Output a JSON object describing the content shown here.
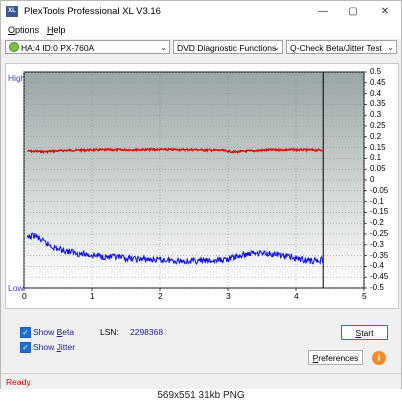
{
  "window": {
    "title": "PlexTools Professional XL V3.16",
    "app_icon": "XL",
    "minimize": "—",
    "maximize": "▢",
    "close": "✕"
  },
  "menu": [
    {
      "label": "Options",
      "accel": "O",
      "rest": "ptions"
    },
    {
      "label": "Help",
      "accel": "H",
      "rest": "elp"
    }
  ],
  "toolbar": {
    "drive": "HA:4 ID:0  PX-760A",
    "function": "DVD Diagnostic Functions",
    "test": "Q-Check Beta/Jitter Test"
  },
  "chart_data": {
    "type": "line",
    "left_axis": {
      "top_label": "High",
      "bottom_label": "Low"
    },
    "x_ticks": [
      "0",
      "1",
      "2",
      "3",
      "4",
      "5"
    ],
    "xlim": [
      0,
      5
    ],
    "y_ticks": [
      "0.5",
      "0.45",
      "0.4",
      "0.35",
      "0.3",
      "0.25",
      "0.2",
      "0.15",
      "0.1",
      "0.05",
      "0",
      "-0.05",
      "-0.1",
      "-0.15",
      "-0.2",
      "-0.25",
      "-0.3",
      "-0.35",
      "-0.4",
      "-0.45",
      "-0.5"
    ],
    "ylim": [
      -0.5,
      0.5
    ],
    "end_marker_x": 4.4,
    "background_top": "#9aa5a5",
    "background_bottom": "#ffffff",
    "series": [
      {
        "color": "#e00000",
        "x": [
          0.05,
          0.3,
          0.6,
          1.0,
          1.5,
          2.0,
          2.5,
          2.9,
          3.1,
          3.3,
          3.6,
          4.0,
          4.4
        ],
        "y": [
          0.134,
          0.131,
          0.137,
          0.139,
          0.14,
          0.141,
          0.14,
          0.137,
          0.13,
          0.134,
          0.139,
          0.14,
          0.138
        ]
      },
      {
        "color": "#1010e0",
        "x": [
          0.05,
          0.15,
          0.3,
          0.5,
          0.8,
          1.2,
          1.6,
          2.0,
          2.4,
          2.8,
          3.0,
          3.2,
          3.4,
          3.6,
          3.9,
          4.2,
          4.4
        ],
        "y": [
          -0.27,
          -0.255,
          -0.29,
          -0.32,
          -0.34,
          -0.355,
          -0.365,
          -0.37,
          -0.375,
          -0.375,
          -0.365,
          -0.35,
          -0.335,
          -0.34,
          -0.355,
          -0.375,
          -0.37
        ]
      }
    ]
  },
  "controls": {
    "show_beta": {
      "checked": true,
      "label_pre": "Show ",
      "accel": "B",
      "label_post": "eta"
    },
    "show_jitter": {
      "checked": true,
      "label_pre": "Show ",
      "accel": "J",
      "label_post": "itter"
    },
    "lsn_label": "LSN:",
    "lsn_value": "2298368",
    "start": {
      "accel": "S",
      "rest": "tart"
    },
    "preferences": {
      "accel": "P",
      "rest": "references"
    },
    "info_icon": "i"
  },
  "status": "Ready",
  "caption": "569x551  31kb  PNG"
}
